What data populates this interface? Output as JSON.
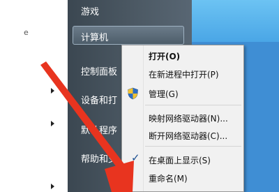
{
  "start_menu": {
    "items": [
      {
        "label": "游戏"
      },
      {
        "label": "计算机"
      },
      {
        "label": "控制面板"
      },
      {
        "label": "设备和打"
      },
      {
        "label": "默认程序"
      },
      {
        "label": "帮助和支"
      }
    ],
    "left_glyph": "e"
  },
  "context_menu": {
    "items": [
      {
        "label": "打开(O)"
      },
      {
        "label": "在新进程中打开(P)"
      },
      {
        "label": "管理(G)"
      },
      {
        "label": "映射网络驱动器(N)..."
      },
      {
        "label": "断开网络驱动器(C)..."
      },
      {
        "label": "在桌面上显示(S)"
      },
      {
        "label": "重命名(M)"
      }
    ]
  },
  "colors": {
    "annotation_arrow": "#e8341f",
    "menu_check": "#1a4d8f"
  }
}
